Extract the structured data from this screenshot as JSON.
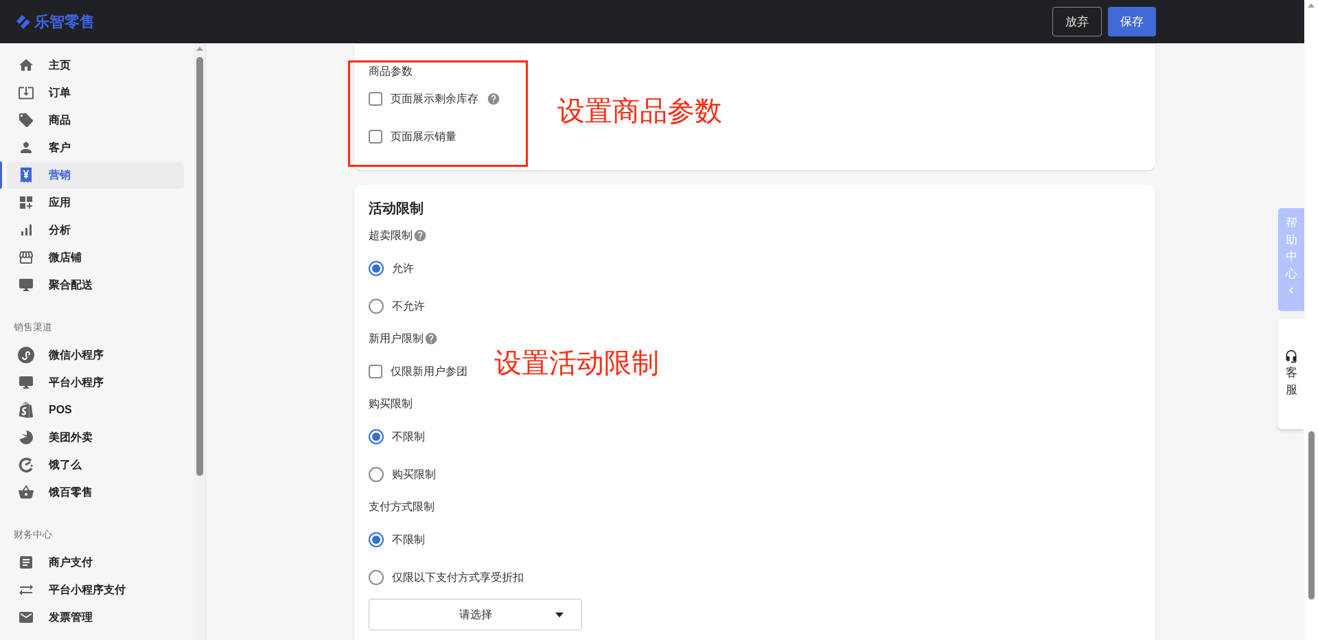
{
  "header": {
    "logo": "乐智零售",
    "buttons": [
      {
        "label": "放弃",
        "kind": "secondary"
      },
      {
        "label": "保存",
        "kind": "primary"
      }
    ]
  },
  "sidebar": {
    "sections": [
      {
        "items": [
          {
            "label": "主页",
            "selected": false
          },
          {
            "label": "订单",
            "selected": false
          },
          {
            "label": "商品",
            "selected": false
          },
          {
            "label": "客户",
            "selected": false
          },
          {
            "label": "营销",
            "selected": true
          },
          {
            "label": "应用",
            "selected": false
          },
          {
            "label": "分析",
            "selected": false
          },
          {
            "label": "微店铺",
            "selected": false
          },
          {
            "label": "聚合配送",
            "selected": false
          }
        ]
      },
      {
        "title": "销售渠道",
        "items": [
          {
            "label": "微信小程序",
            "selected": false
          },
          {
            "label": "平台小程序",
            "selected": false
          },
          {
            "label": "POS",
            "selected": false
          },
          {
            "label": "美团外卖",
            "selected": false
          },
          {
            "label": "饿了么",
            "selected": false
          },
          {
            "label": "饿百零售",
            "selected": false
          }
        ]
      },
      {
        "title": "财务中心",
        "items": [
          {
            "label": "商户支付",
            "selected": false
          },
          {
            "label": "平台小程序支付",
            "selected": false
          },
          {
            "label": "发票管理",
            "selected": false
          }
        ]
      }
    ]
  },
  "product_params": {
    "label": "商品参数",
    "options": [
      {
        "label": "页面展示剩余库存",
        "checked": false,
        "help": true
      },
      {
        "label": "页面展示销量",
        "checked": false,
        "help": false
      }
    ]
  },
  "activity_limits": {
    "title": "活动限制",
    "groups": [
      {
        "label": "超卖限制",
        "help": true,
        "kind": "radio",
        "options": [
          {
            "label": "允许",
            "selected": true
          },
          {
            "label": "不允许",
            "selected": false
          }
        ]
      },
      {
        "label": "新用户限制",
        "help": true,
        "kind": "checkbox",
        "options": [
          {
            "label": "仅限新用户参团",
            "checked": false
          }
        ]
      },
      {
        "label": "购买限制",
        "help": false,
        "kind": "radio",
        "options": [
          {
            "label": "不限制",
            "selected": true
          },
          {
            "label": "购买限制",
            "selected": false
          }
        ]
      },
      {
        "label": "支付方式限制",
        "help": false,
        "kind": "radio",
        "options": [
          {
            "label": "不限制",
            "selected": true
          },
          {
            "label": "仅限以下支付方式享受折扣",
            "selected": false
          }
        ],
        "select": {
          "placeholder": "请选择"
        }
      }
    ]
  },
  "annotations": [
    {
      "text": "设置商品参数"
    },
    {
      "text": "设置活动限制"
    }
  ],
  "floating": {
    "help_center": {
      "label": "帮助中心"
    },
    "customer_service": {
      "label": "客服"
    }
  }
}
